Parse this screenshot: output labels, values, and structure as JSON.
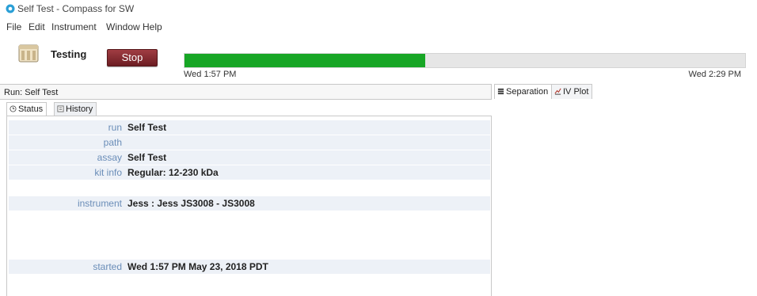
{
  "window": {
    "title": "Self Test - Compass for SW"
  },
  "menu": [
    "File",
    "Edit",
    "Instrument",
    "Window",
    "Help"
  ],
  "toolbar": {
    "status": "Testing",
    "stop_label": "Stop",
    "progress_fraction": 0.43,
    "progress_color": "#17a625",
    "start_time": "Wed 1:57 PM",
    "end_time": "Wed 2:29 PM"
  },
  "run_panel": {
    "header": "Run: Self Test",
    "tabs": {
      "status": "Status",
      "history": "History"
    },
    "fields": {
      "run": {
        "label": "run",
        "value": "Self Test"
      },
      "path": {
        "label": "path",
        "value": ""
      },
      "assay": {
        "label": "assay",
        "value": "Self Test"
      },
      "kit_info": {
        "label": "kit info",
        "value": "Regular: 12-230 kDa"
      },
      "instrument": {
        "label": "instrument",
        "value": "Jess : Jess JS3008 - JS3008"
      },
      "started": {
        "label": "started",
        "value": "Wed 1:57 PM May 23, 2018 PDT"
      }
    }
  },
  "right_tabs": {
    "separation": "Separation",
    "iv_plot": "IV Plot"
  }
}
